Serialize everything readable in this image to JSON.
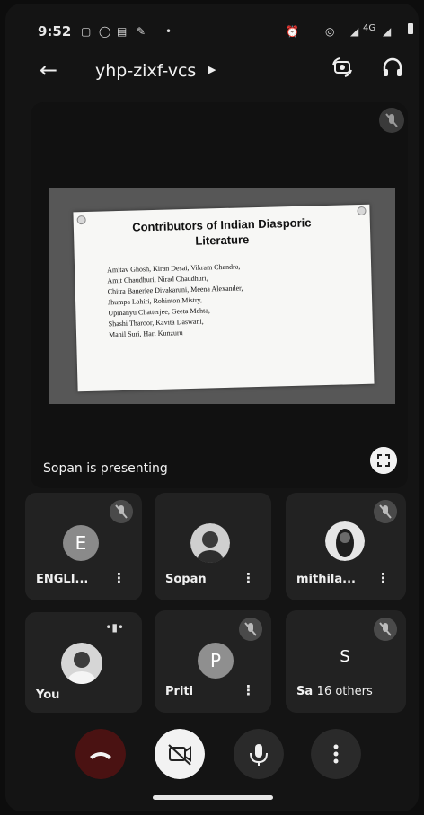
{
  "status_bar": {
    "time": "9:52",
    "network": "4G"
  },
  "app_bar": {
    "meeting_code": "yhp-zixf-vcs"
  },
  "icons": {
    "back": "arrow-left-icon",
    "camera_switch": "camera-rotate-icon",
    "audio": "headphones-icon",
    "muted": "mic-off-icon",
    "menu": "more-vert-icon"
  },
  "presentation": {
    "status_text": "Sopan is presenting",
    "slide": {
      "title_line1": "Contributors of Indian Diasporic",
      "title_line2": "Literature",
      "lines": [
        "Amitav Ghosh, Kiran Desai, Vikram Chandra,",
        "Amit Chaudhuri, Nirad Chaudhuri,",
        "Chitra Banerjee Divakaruni, Meena Alexander,",
        "Jhumpa Lahiri, Rohinton Mistry,",
        "Upmanyu Chatterjee, Geeta Mehta,",
        "Shashi Tharoor, Kavita Daswani,",
        "Manil Suri, Hari Kunzuru"
      ]
    }
  },
  "participants": [
    {
      "name": "ENGLI...",
      "initial": "E",
      "muted": true
    },
    {
      "name": "Sopan",
      "muted": false
    },
    {
      "name": "mithila...",
      "muted": true
    },
    {
      "name": "You",
      "muted": false
    },
    {
      "name": "Priti",
      "initial": "P",
      "muted": true
    },
    {
      "name": "Sa",
      "initial": "S",
      "others": "16 others",
      "muted": true
    }
  ],
  "colors": {
    "end_call": "#4a1212",
    "camera_off_bg": "#f2f2f2",
    "avatar_e": "#8a8a8a",
    "avatar_p": "#8f8f8f",
    "tile_bg": "#222222"
  }
}
